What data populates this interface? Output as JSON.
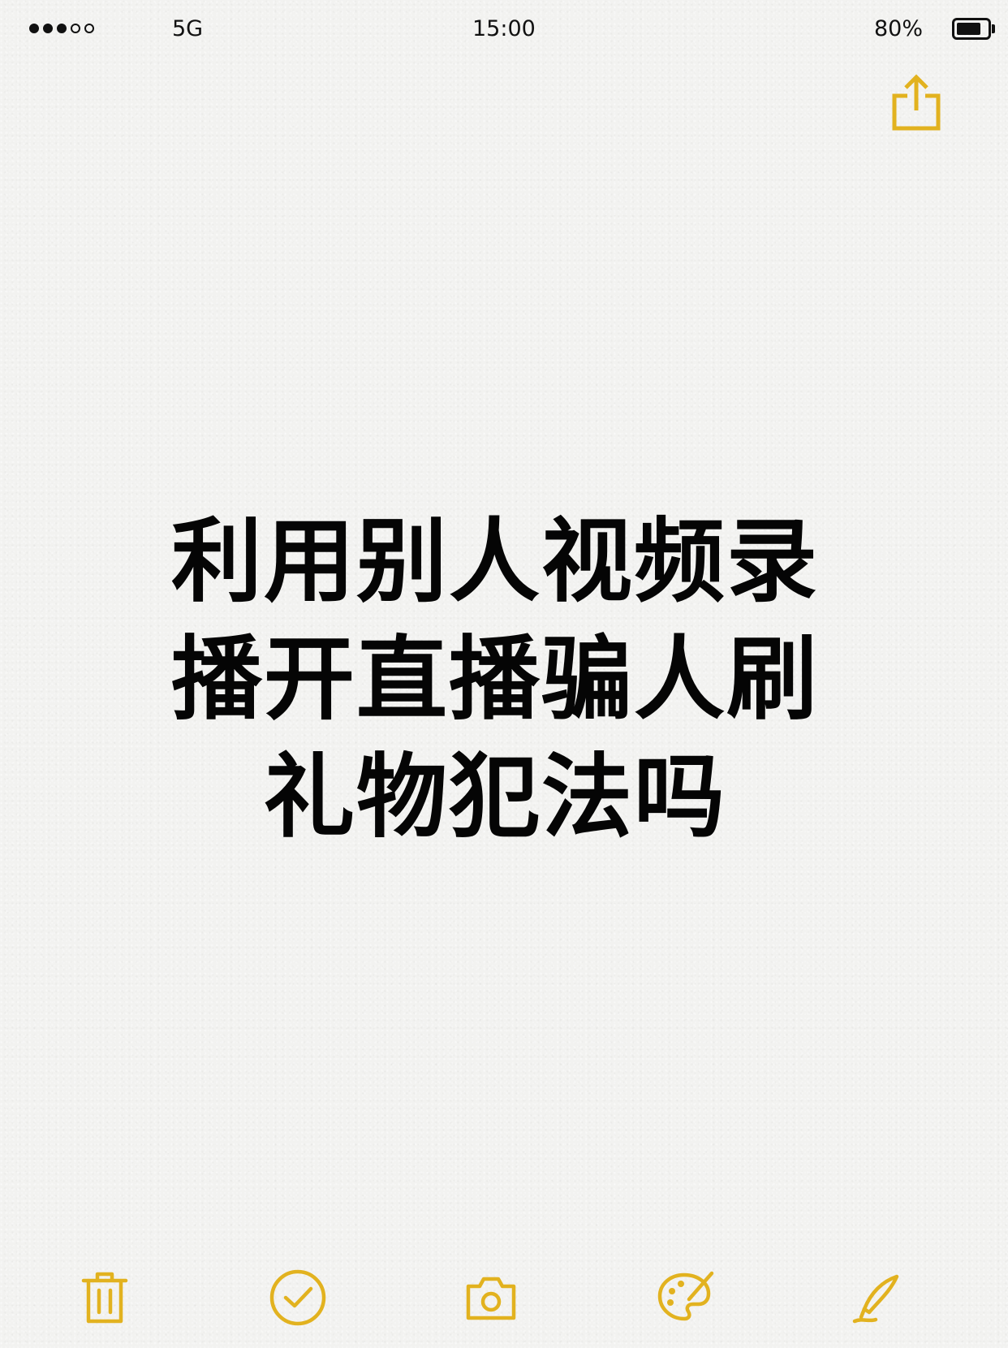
{
  "status_bar": {
    "signal_dots_filled": 3,
    "signal_dots_total": 5,
    "network": "5G",
    "time": "15:00",
    "battery_percent": "80%",
    "battery_level": 0.8
  },
  "header": {
    "share_icon": "share-icon"
  },
  "note": {
    "title_lines": [
      "利用别人视频录",
      "播开直播骗人刷",
      "礼物犯法吗"
    ]
  },
  "toolbar": {
    "items": [
      "trash-icon",
      "checklist-icon",
      "camera-icon",
      "palette-icon",
      "pen-icon"
    ]
  },
  "colors": {
    "accent": "#e2b21f",
    "text": "#050505",
    "background": "#f2f2f0"
  }
}
